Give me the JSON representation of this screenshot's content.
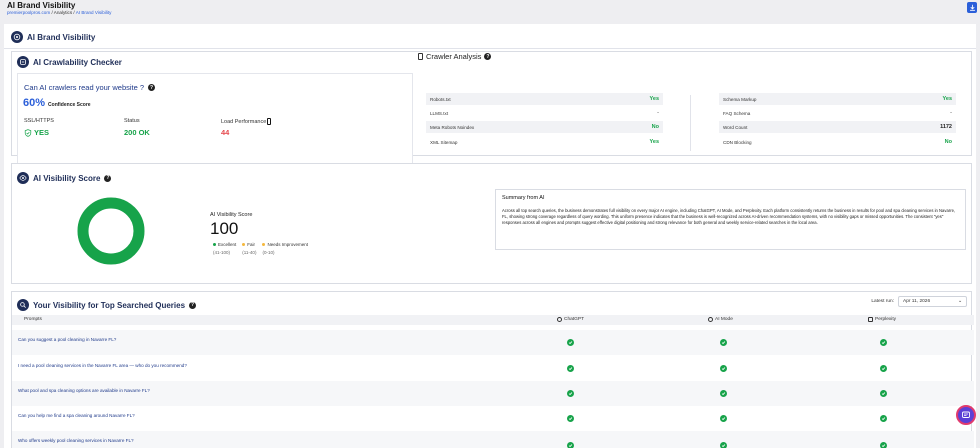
{
  "header": {
    "title": "AI Brand Visibility",
    "breadcrumb": {
      "site": "premierpoolpros.com",
      "analytics": "Analytics",
      "current": "AI Brand Visibility"
    }
  },
  "panel": {
    "title": "AI Brand Visibility"
  },
  "crawlability": {
    "title": "AI Crawlability Checker",
    "question": "Can AI crawlers read your website ?",
    "confidence_value": "60%",
    "confidence_label": "Confidence Score",
    "ssl_label": "SSL/HTTPS",
    "ssl_value": "YES",
    "status_label": "Status",
    "status_value": "200 OK",
    "load_label": "Load Performance",
    "load_value": "44"
  },
  "crawler_analysis": {
    "title": "Crawler Analysis",
    "left": [
      {
        "label": "Robots.txt",
        "value": "Yes"
      },
      {
        "label": "LLMS.txt",
        "value": "-"
      },
      {
        "label": "Meta Robots Noindex",
        "value": "No"
      },
      {
        "label": "XML Sitemap",
        "value": "Yes"
      }
    ],
    "right": [
      {
        "label": "Schema Markup",
        "value": "Yes"
      },
      {
        "label": "FAQ Schema",
        "value": "-"
      },
      {
        "label": "Word Count",
        "value": "1172"
      },
      {
        "label": "CDN Blocking",
        "value": "No"
      }
    ]
  },
  "visibility": {
    "title": "AI Visibility Score",
    "score_label": "AI Visibility Score",
    "score": "100",
    "score_fraction": 1.0,
    "legend": [
      {
        "label": "Excellent",
        "range": "(41-100)",
        "color": "#17a34a"
      },
      {
        "label": "Fair",
        "range": "(11-40)",
        "color": "#f5b83d"
      },
      {
        "label": "Needs Improvement",
        "range": "(0-10)",
        "color": "#f5b83d"
      }
    ],
    "summary_title": "Summary from AI",
    "summary_text": "Across all top search queries, the business demonstrates full visibility on every major AI engine, including ChatGPT, AI Mode, and Perplexity. Each platform consistently returns the business in results for pool and spa cleaning services in Navarre, FL, showing strong coverage regardless of query wording. This uniform presence indicates that the business is well-recognized across AI-driven recommendation systems, with no visibility gaps or missed opportunities. The consistent \"yes\" responses across all engines and prompts suggest effective digital positioning and strong relevance for both general and weekly service-related searches in the local area."
  },
  "queries": {
    "title": "Your Visibility for Top Searched Queries",
    "latest_label": "Latest run:",
    "latest_value": "Apr 11, 2026",
    "columns": {
      "prompts": "Prompts",
      "chatgpt": "ChatGPT",
      "aimode": "AI Mode",
      "perplexity": "Perplexity"
    },
    "rows": [
      {
        "prompt": "Can you suggest a pool cleaning in Navarre FL?"
      },
      {
        "prompt": "I need a pool cleaning services in the Navarre FL area — who do you recommend?"
      },
      {
        "prompt": "What pool and spa cleaning options are available in Navarre FL?"
      },
      {
        "prompt": "Can you help me find a spa cleaning around Navarre FL?"
      },
      {
        "prompt": "Who offers weekly pool cleaning services in Navarre FL?"
      }
    ]
  },
  "colors": {
    "accent": "#2b5fd9",
    "navy": "#1f2e58",
    "success": "#17a34a",
    "danger": "#e5484d"
  }
}
